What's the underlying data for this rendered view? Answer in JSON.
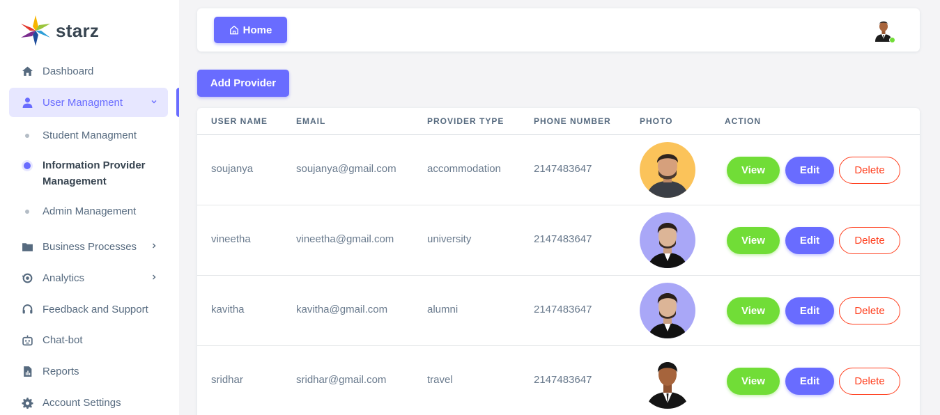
{
  "brand": {
    "name": "starz"
  },
  "sidebar": {
    "items": [
      {
        "label": "Dashboard",
        "icon": "home-icon"
      },
      {
        "label": "User Managment",
        "icon": "user-icon"
      },
      {
        "label": "Business Processes",
        "icon": "folder-icon"
      },
      {
        "label": "Analytics",
        "icon": "analytics-icon"
      },
      {
        "label": "Feedback and Support",
        "icon": "headset-icon"
      },
      {
        "label": "Chat-bot",
        "icon": "bot-icon"
      },
      {
        "label": "Reports",
        "icon": "report-icon"
      },
      {
        "label": "Account Settings",
        "icon": "gear-icon"
      }
    ],
    "sub_items": [
      {
        "label": "Student Managment"
      },
      {
        "label": "Information Provider Management"
      },
      {
        "label": "Admin Management"
      }
    ]
  },
  "navbar": {
    "home_label": "Home"
  },
  "actions": {
    "add_provider_label": "Add Provider"
  },
  "table": {
    "headers": [
      "USER NAME",
      "EMAIL",
      "PROVIDER TYPE",
      "PHONE NUMBER",
      "PHOTO",
      "ACTION"
    ],
    "buttons": {
      "view": "View",
      "edit": "Edit",
      "delete": "Delete"
    },
    "rows": [
      {
        "user_name": "soujanya",
        "email": "soujanya@gmail.com",
        "provider_type": "accommodation",
        "phone": "2147483647"
      },
      {
        "user_name": "vineetha",
        "email": "vineetha@gmail.com",
        "provider_type": "university",
        "phone": "2147483647"
      },
      {
        "user_name": "kavitha",
        "email": "kavitha@gmail.com",
        "provider_type": "alumni",
        "phone": "2147483647"
      },
      {
        "user_name": "sridhar",
        "email": "sridhar@gmail.com",
        "provider_type": "travel",
        "phone": "2147483647"
      }
    ]
  },
  "colors": {
    "primary": "#696cff",
    "success": "#71dd37",
    "danger": "#ff3e1d"
  }
}
